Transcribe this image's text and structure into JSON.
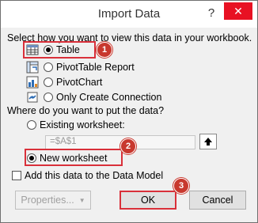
{
  "window": {
    "title": "Import Data",
    "help": "?",
    "close": "✕"
  },
  "view_section": {
    "prompt": "Select how you want to view this data in your workbook.",
    "options": [
      {
        "label": "Table",
        "selected": true
      },
      {
        "label": "PivotTable Report",
        "selected": false
      },
      {
        "label": "PivotChart",
        "selected": false
      },
      {
        "label": "Only Create Connection",
        "selected": false
      }
    ]
  },
  "location_section": {
    "prompt": "Where do you want to put the data?",
    "existing_label": "Existing worksheet:",
    "existing_value": "=$A$1",
    "new_label": "New worksheet"
  },
  "data_model_label": "Add this data to the Data Model",
  "buttons": {
    "properties": "Properties...",
    "properties_arrow": "▼",
    "ok": "OK",
    "cancel": "Cancel"
  },
  "badges": [
    "1",
    "2",
    "3"
  ],
  "colors": {
    "highlight": "#d9303a",
    "badge": "#c8382e",
    "close": "#e81123"
  }
}
